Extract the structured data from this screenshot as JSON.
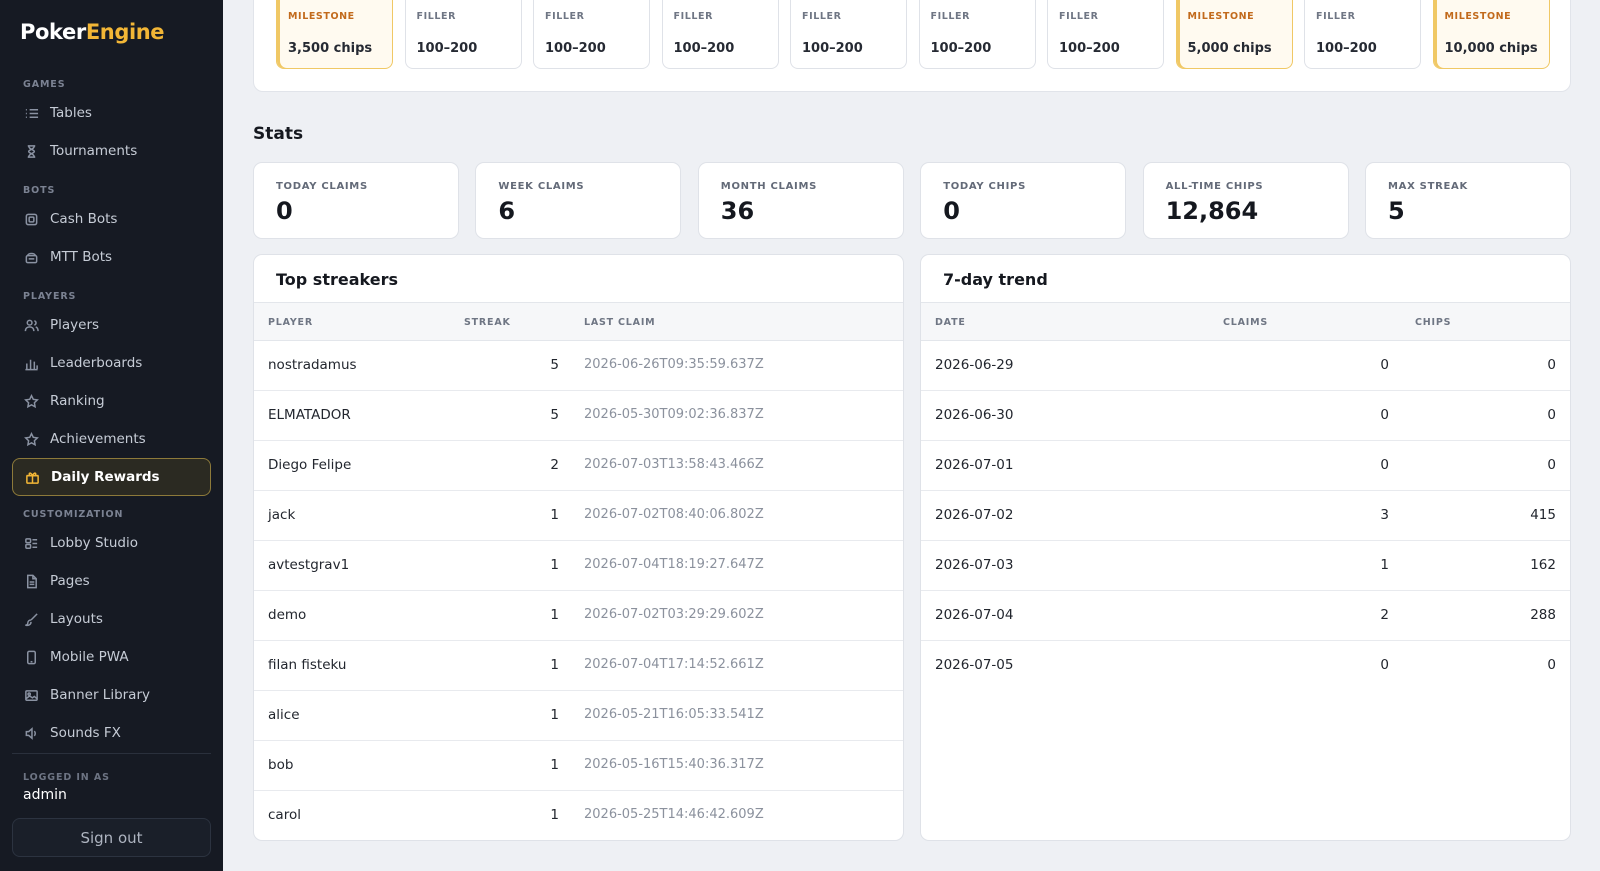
{
  "brand": {
    "part1": "Poker",
    "part2": "Engine"
  },
  "sidebar": {
    "sections": [
      {
        "label": "GAMES",
        "items": [
          {
            "label": "Tables",
            "icon": "list-icon"
          },
          {
            "label": "Tournaments",
            "icon": "hourglass-icon"
          }
        ]
      },
      {
        "label": "BOTS",
        "items": [
          {
            "label": "Cash Bots",
            "icon": "chip-icon"
          },
          {
            "label": "MTT Bots",
            "icon": "robot-icon"
          }
        ]
      },
      {
        "label": "PLAYERS",
        "items": [
          {
            "label": "Players",
            "icon": "users-icon"
          },
          {
            "label": "Leaderboards",
            "icon": "bar-chart-icon"
          },
          {
            "label": "Ranking",
            "icon": "star-icon"
          },
          {
            "label": "Achievements",
            "icon": "star-icon"
          },
          {
            "label": "Daily Rewards",
            "icon": "gift-icon",
            "active": true
          }
        ]
      },
      {
        "label": "CUSTOMIZATION",
        "items": [
          {
            "label": "Lobby Studio",
            "icon": "layout-icon"
          },
          {
            "label": "Pages",
            "icon": "document-icon"
          },
          {
            "label": "Layouts",
            "icon": "brush-icon"
          },
          {
            "label": "Mobile PWA",
            "icon": "mobile-icon"
          },
          {
            "label": "Banner Library",
            "icon": "image-icon"
          },
          {
            "label": "Sounds FX",
            "icon": "sound-icon"
          }
        ]
      }
    ],
    "logged_label": "LOGGED IN AS",
    "logged_user": "admin",
    "sign_out": "Sign out"
  },
  "reward_days": [
    {
      "kind": "MILESTONE",
      "amount": "3,500 chips",
      "milestone": true
    },
    {
      "kind": "FILLER",
      "amount": "100–200",
      "milestone": false
    },
    {
      "kind": "FILLER",
      "amount": "100–200",
      "milestone": false
    },
    {
      "kind": "FILLER",
      "amount": "100–200",
      "milestone": false
    },
    {
      "kind": "FILLER",
      "amount": "100–200",
      "milestone": false
    },
    {
      "kind": "FILLER",
      "amount": "100–200",
      "milestone": false
    },
    {
      "kind": "FILLER",
      "amount": "100–200",
      "milestone": false
    },
    {
      "kind": "MILESTONE",
      "amount": "5,000 chips",
      "milestone": true
    },
    {
      "kind": "FILLER",
      "amount": "100–200",
      "milestone": false
    },
    {
      "kind": "MILESTONE",
      "amount": "10,000 chips",
      "milestone": true
    }
  ],
  "stats": {
    "title": "Stats",
    "cards": [
      {
        "label": "TODAY CLAIMS",
        "value": "0"
      },
      {
        "label": "WEEK CLAIMS",
        "value": "6"
      },
      {
        "label": "MONTH CLAIMS",
        "value": "36"
      },
      {
        "label": "TODAY CHIPS",
        "value": "0"
      },
      {
        "label": "ALL-TIME CHIPS",
        "value": "12,864"
      },
      {
        "label": "MAX STREAK",
        "value": "5"
      }
    ]
  },
  "streakers": {
    "title": "Top streakers",
    "columns": [
      "PLAYER",
      "STREAK",
      "LAST CLAIM"
    ],
    "rows": [
      [
        "nostradamus",
        "5",
        "2026-06-26T09:35:59.637Z"
      ],
      [
        "ELMATADOR",
        "5",
        "2026-05-30T09:02:36.837Z"
      ],
      [
        "Diego Felipe",
        "2",
        "2026-07-03T13:58:43.466Z"
      ],
      [
        "jack",
        "1",
        "2026-07-02T08:40:06.802Z"
      ],
      [
        "avtestgrav1",
        "1",
        "2026-07-04T18:19:27.647Z"
      ],
      [
        "demo",
        "1",
        "2026-07-02T03:29:29.602Z"
      ],
      [
        "filan fisteku",
        "1",
        "2026-07-04T17:14:52.661Z"
      ],
      [
        "alice",
        "1",
        "2026-05-21T16:05:33.541Z"
      ],
      [
        "bob",
        "1",
        "2026-05-16T15:40:36.317Z"
      ],
      [
        "carol",
        "1",
        "2026-05-25T14:46:42.609Z"
      ]
    ]
  },
  "trend": {
    "title": "7-day trend",
    "columns": [
      "DATE",
      "CLAIMS",
      "CHIPS"
    ],
    "rows": [
      [
        "2026-06-29",
        "0",
        "0"
      ],
      [
        "2026-06-30",
        "0",
        "0"
      ],
      [
        "2026-07-01",
        "0",
        "0"
      ],
      [
        "2026-07-02",
        "3",
        "415"
      ],
      [
        "2026-07-03",
        "1",
        "162"
      ],
      [
        "2026-07-04",
        "2",
        "288"
      ],
      [
        "2026-07-05",
        "0",
        "0"
      ]
    ]
  }
}
